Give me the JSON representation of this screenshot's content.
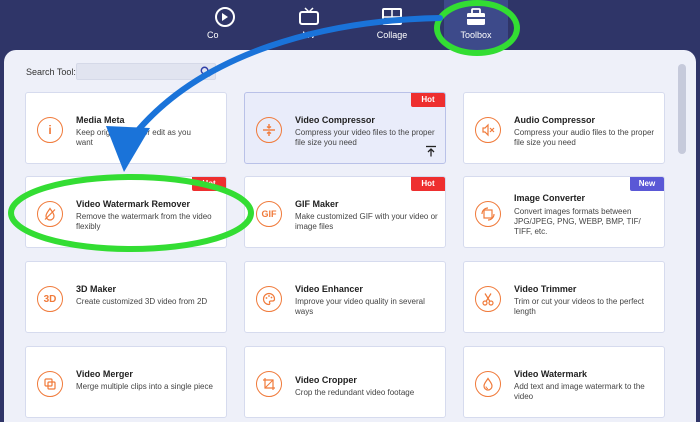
{
  "nav": {
    "items": [
      {
        "label": "Converter",
        "icon": "convert-icon"
      },
      {
        "label": "MV",
        "icon": "tv-icon"
      },
      {
        "label": "Collage",
        "icon": "collage-icon"
      },
      {
        "label": "Toolbox",
        "icon": "toolbox-icon"
      }
    ],
    "converter_visible": "Co"
  },
  "search": {
    "label": "Search Tool:",
    "value": ""
  },
  "tools": [
    {
      "title": "Media Metadata Editor",
      "title_visible": "Media Meta",
      "desc": "Keep original ... or edit as you want",
      "desc_line1": "Keep origina",
      "desc_line1b": "or edit as you",
      "desc_line2": "want",
      "icon": "info-icon",
      "badge": ""
    },
    {
      "title": "Video Compressor",
      "desc": "Compress your video files to the proper file size you need",
      "icon": "compress-icon",
      "badge": "Hot"
    },
    {
      "title": "Audio Compressor",
      "desc": "Compress your audio files to the proper file size you need",
      "icon": "audio-compress-icon",
      "badge": ""
    },
    {
      "title": "Video Watermark Remover",
      "desc": "Remove the watermark from the video flexibly",
      "icon": "watermark-remove-icon",
      "badge": "Hot"
    },
    {
      "title": "GIF Maker",
      "desc": "Make customized GIF with your video or image files",
      "icon": "gif-icon",
      "badge": "Hot"
    },
    {
      "title": "Image Converter",
      "desc": "Convert images formats between JPG/JPEG, PNG, WEBP, BMP, TIF/ TIFF, etc.",
      "icon": "image-convert-icon",
      "badge": "New"
    },
    {
      "title": "3D Maker",
      "desc": "Create customized 3D video from 2D",
      "icon": "3d-icon",
      "badge": ""
    },
    {
      "title": "Video Enhancer",
      "desc": "Improve your video quality in several ways",
      "icon": "palette-icon",
      "badge": ""
    },
    {
      "title": "Video Trimmer",
      "desc": "Trim or cut your videos to the perfect length",
      "icon": "scissors-icon",
      "badge": ""
    },
    {
      "title": "Video Merger",
      "desc": "Merge multiple clips into a single piece",
      "icon": "merge-icon",
      "badge": ""
    },
    {
      "title": "Video Cropper",
      "desc": "Crop the redundant video footage",
      "icon": "crop-icon",
      "badge": ""
    },
    {
      "title": "Video Watermark",
      "desc": "Add text and image watermark to the video",
      "icon": "watermark-drop-icon",
      "badge": ""
    }
  ],
  "icon_text": {
    "gif": "GIF",
    "three_d": "3D",
    "info": "i"
  },
  "colors": {
    "accent": "#f07a3a",
    "highlight": "#33dd33",
    "arrow": "#1a73d9",
    "hot": "#ee2f2f",
    "new": "#5a58d6",
    "nav_bg": "#2f3568"
  }
}
